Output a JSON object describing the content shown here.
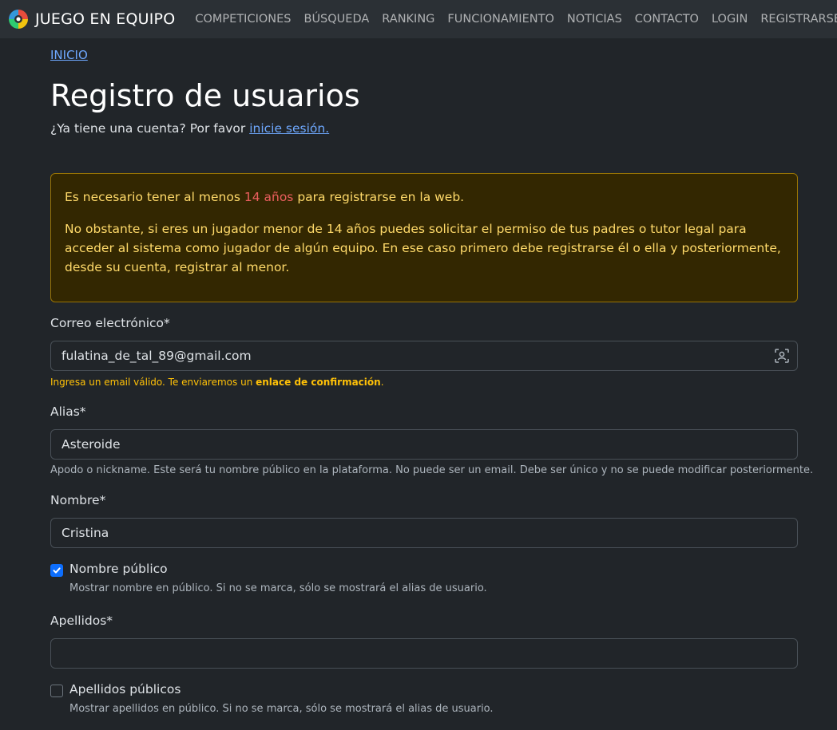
{
  "navbar": {
    "brand": "JUEGO EN EQUIPO",
    "links": [
      "COMPETICIONES",
      "BÚSQUEDA",
      "RANKING",
      "FUNCIONAMIENTO",
      "NOTICIAS",
      "CONTACTO",
      "LOGIN",
      "REGISTRARSE"
    ]
  },
  "breadcrumb": "INICIO",
  "page": {
    "title": "Registro de usuarios",
    "login_prompt": "¿Ya tiene una cuenta? Por favor",
    "login_link": "inicie sesión."
  },
  "alert": {
    "p1_before": "Es necesario tener al menos",
    "p1_highlight": "14 años",
    "p1_after": "para registrarse en la web.",
    "p2": "No obstante, si eres un jugador menor de 14 años puedes solicitar el permiso de tus padres o tutor legal para acceder al sistema como jugador de algún equipo. En ese caso primero debe registrarse él o ella y posteriormente, desde su cuenta, registrar al menor."
  },
  "form": {
    "email": {
      "label": "Correo electrónico*",
      "value": "fulatina_de_tal_89@gmail.com",
      "help_before": "Ingresa un email válido. Te enviaremos un",
      "help_strong": "enlace de confirmación",
      "help_after": "."
    },
    "alias": {
      "label": "Alias*",
      "value": "Asteroide",
      "help": "Apodo o nickname. Este será tu nombre público en la plataforma. No puede ser un email. Debe ser único y no se puede modificar posteriormente."
    },
    "nombre": {
      "label": "Nombre*",
      "value": "Cristina"
    },
    "nombre_publico": {
      "label": "Nombre público",
      "checked": true,
      "help": "Mostrar nombre en público. Si no se marca, sólo se mostrará el alias de usuario."
    },
    "apellidos": {
      "label": "Apellidos*",
      "value": ""
    },
    "apellidos_publicos": {
      "label": "Apellidos públicos",
      "checked": false,
      "help": "Mostrar apellidos en público. Si no se marca, sólo se mostrará el alias de usuario."
    }
  },
  "colors": {
    "background": "#212529",
    "navbar": "#2b3035",
    "link": "#6ea8fe",
    "alert_bg": "#332701",
    "alert_text": "#ffda6a",
    "alert_highlight": "#ea5e5e",
    "checkbox_checked": "#0d6efd"
  }
}
